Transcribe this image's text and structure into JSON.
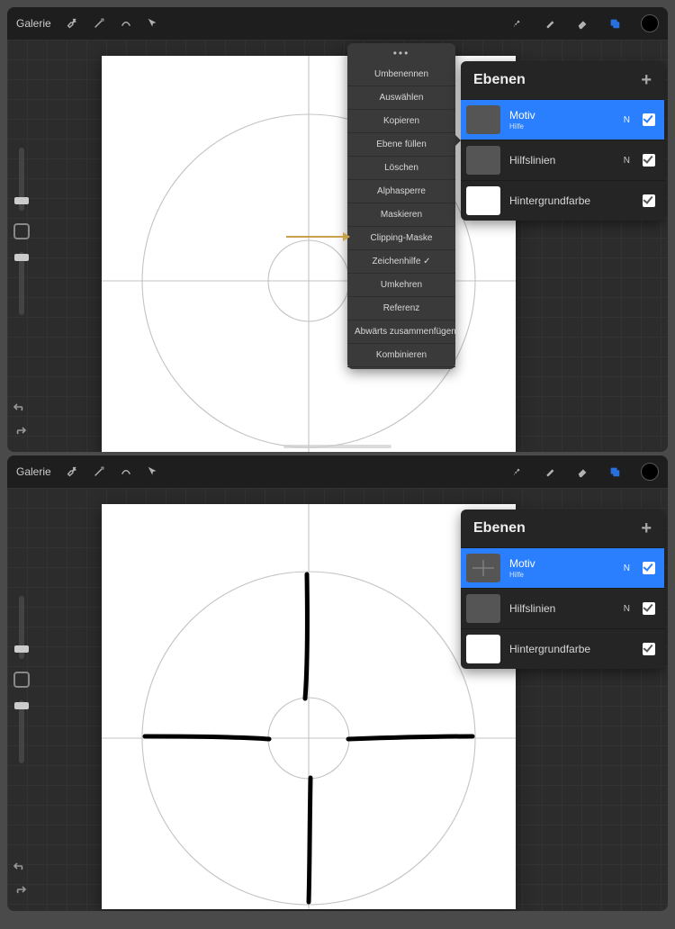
{
  "toolbar": {
    "gallery_label": "Galerie"
  },
  "ctx_menu": {
    "items": [
      "Umbenennen",
      "Auswählen",
      "Kopieren",
      "Ebene füllen",
      "Löschen",
      "Alphasperre",
      "Maskieren",
      "Clipping-Maske",
      "Zeichenhilfe ✓",
      "Umkehren",
      "Referenz",
      "Abwärts zusammenfügen",
      "Kombinieren"
    ]
  },
  "layers_top": {
    "title": "Ebenen",
    "rows": [
      {
        "name": "Motiv",
        "sub": "Hilfe",
        "blend": "N",
        "selected": true,
        "thumb": "blank"
      },
      {
        "name": "Hilfslinien",
        "sub": "",
        "blend": "N",
        "selected": false,
        "thumb": "blank"
      },
      {
        "name": "Hintergrundfarbe",
        "sub": "",
        "blend": "",
        "selected": false,
        "thumb": "white"
      }
    ]
  },
  "layers_bottom": {
    "title": "Ebenen",
    "rows": [
      {
        "name": "Motiv",
        "sub": "Hilfe",
        "blend": "N",
        "selected": true,
        "thumb": "blank"
      },
      {
        "name": "Hilfslinien",
        "sub": "",
        "blend": "N",
        "selected": false,
        "thumb": "blank"
      },
      {
        "name": "Hintergrundfarbe",
        "sub": "",
        "blend": "",
        "selected": false,
        "thumb": "white"
      }
    ]
  }
}
